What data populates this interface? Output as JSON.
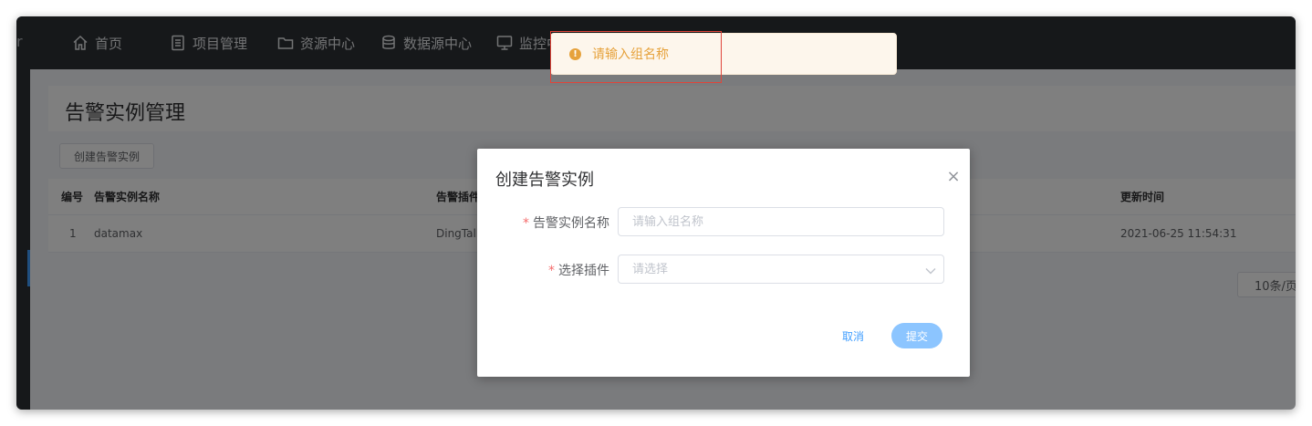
{
  "header": {
    "brand_fragment": "r",
    "nav": [
      {
        "label": "首页",
        "icon": "home-icon"
      },
      {
        "label": "项目管理",
        "icon": "document-icon"
      },
      {
        "label": "资源中心",
        "icon": "folder-icon"
      },
      {
        "label": "数据源中心",
        "icon": "database-icon"
      },
      {
        "label": "监控中",
        "icon": "monitor-icon"
      }
    ]
  },
  "page": {
    "title": "告警实例管理",
    "create_button": "创建告警实例"
  },
  "table": {
    "columns": [
      "编号",
      "告警实例名称",
      "告警插件",
      "更新时间"
    ],
    "rows": [
      {
        "index": "1",
        "name": "datamax",
        "plugin": "DingTalk",
        "updated": "2021-06-25 11:54:31"
      }
    ]
  },
  "pagination": {
    "page_size": "10条/页"
  },
  "dialog": {
    "title": "创建告警实例",
    "fields": [
      {
        "required": "*",
        "label": "告警实例名称",
        "placeholder": "请输入组名称",
        "value": ""
      },
      {
        "required": "*",
        "label": "选择插件",
        "placeholder": "请选择",
        "value": ""
      }
    ],
    "cancel_label": "取消",
    "submit_label": "提交",
    "close_glyph": "×"
  },
  "toast": {
    "type": "warning",
    "icon_glyph": "!",
    "message": "请输入组名称"
  },
  "colors": {
    "header_bg": "#2d3035",
    "accent": "#409eff",
    "warning": "#e6a23c",
    "required": "#f56c6c",
    "submit_bg": "#8cc5ff"
  }
}
